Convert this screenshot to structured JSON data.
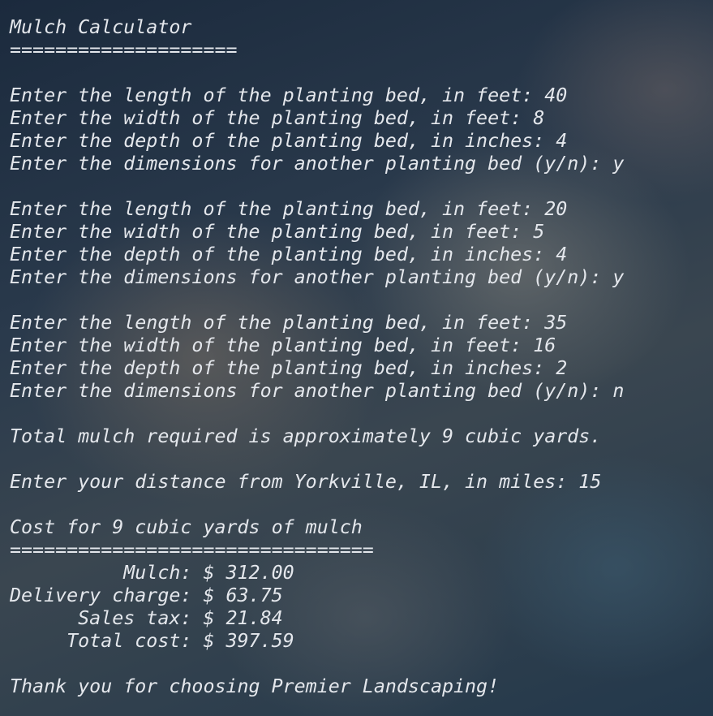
{
  "terminal": {
    "lines": [
      "Mulch Calculator",
      "====================",
      "",
      "Enter the length of the planting bed, in feet: 40",
      "Enter the width of the planting bed, in feet: 8",
      "Enter the depth of the planting bed, in inches: 4",
      "Enter the dimensions for another planting bed (y/n): y",
      "",
      "Enter the length of the planting bed, in feet: 20",
      "Enter the width of the planting bed, in feet: 5",
      "Enter the depth of the planting bed, in inches: 4",
      "Enter the dimensions for another planting bed (y/n): y",
      "",
      "Enter the length of the planting bed, in feet: 35",
      "Enter the width of the planting bed, in feet: 16",
      "Enter the depth of the planting bed, in inches: 2",
      "Enter the dimensions for another planting bed (y/n): n",
      "",
      "Total mulch required is approximately 9 cubic yards.",
      "",
      "Enter your distance from Yorkville, IL, in miles: 15",
      "",
      "Cost for 9 cubic yards of mulch",
      "================================",
      "          Mulch: $ 312.00",
      "Delivery charge: $ 63.75",
      "      Sales tax: $ 21.84",
      "     Total cost: $ 397.59",
      "",
      "Thank you for choosing Premier Landscaping!"
    ]
  }
}
